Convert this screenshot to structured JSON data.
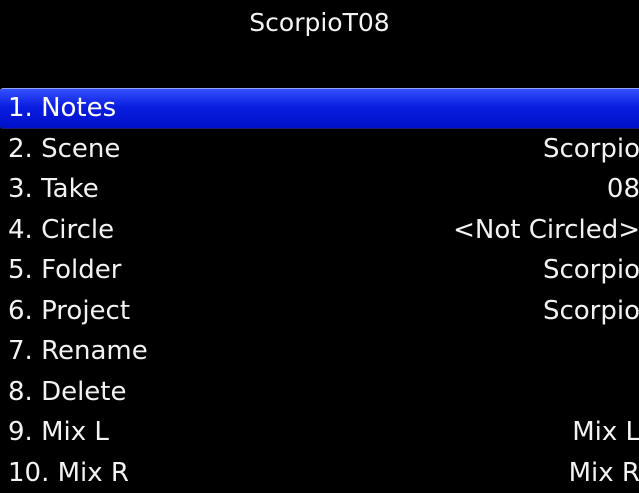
{
  "header": {
    "title": "ScorpioT08"
  },
  "menu": {
    "items": [
      {
        "label": "1. Notes",
        "value": ""
      },
      {
        "label": "2. Scene",
        "value": "Scorpio"
      },
      {
        "label": "3. Take",
        "value": "08"
      },
      {
        "label": "4. Circle",
        "value": "<Not Circled>"
      },
      {
        "label": "5. Folder",
        "value": "Scorpio"
      },
      {
        "label": "6. Project",
        "value": "Scorpio"
      },
      {
        "label": "7. Rename",
        "value": ""
      },
      {
        "label": "8. Delete",
        "value": ""
      },
      {
        "label": "9. Mix L",
        "value": "Mix L"
      },
      {
        "label": "10. Mix R",
        "value": "Mix R"
      }
    ],
    "selected_index": 0
  },
  "colors": {
    "background": "#000000",
    "text": "#f2f2f2",
    "selection": "#0a1ee0"
  }
}
